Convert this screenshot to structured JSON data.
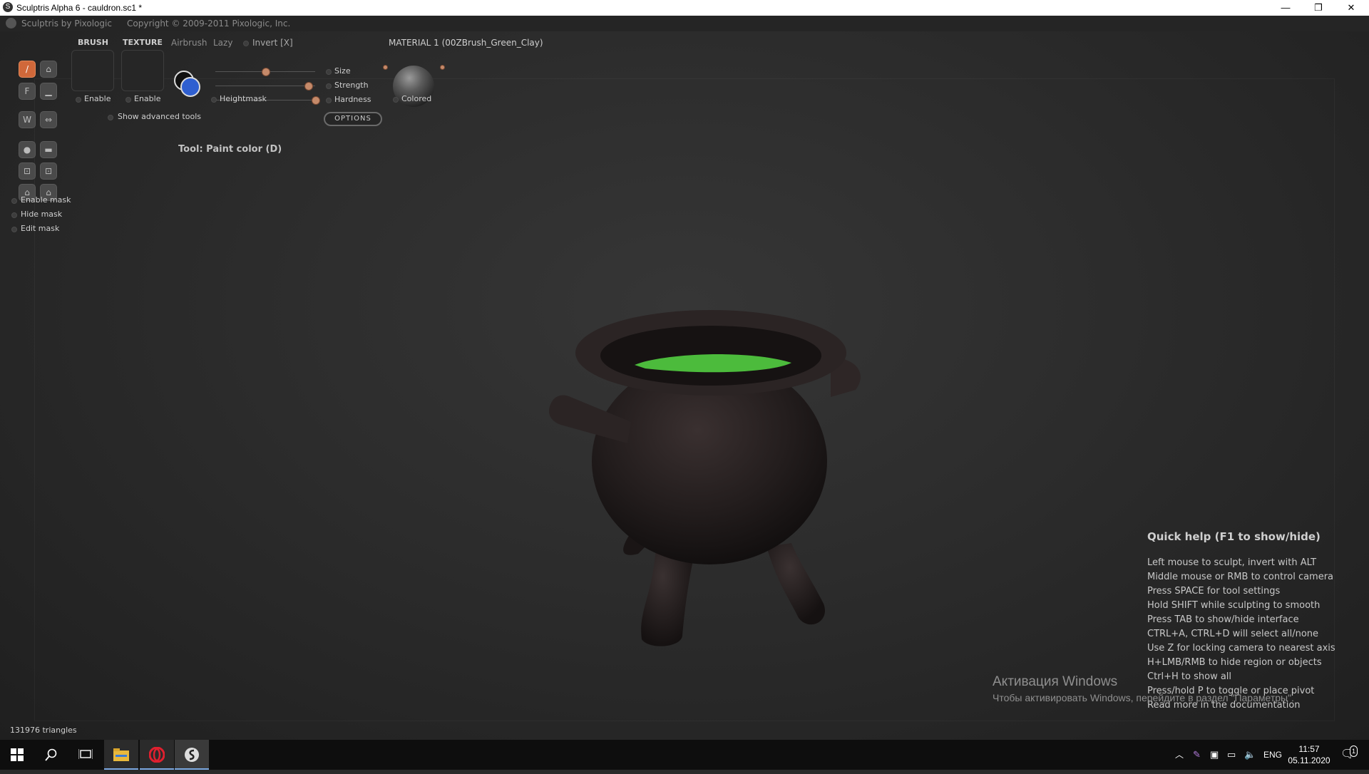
{
  "window": {
    "title": "Sculptris Alpha 6 - cauldron.sc1 *",
    "minimize_glyph": "—",
    "maximize_glyph": "❐",
    "close_glyph": "✕"
  },
  "app_header": {
    "name": "Sculptris by Pixologic",
    "copyright": "Copyright © 2009-2011 Pixologic, Inc."
  },
  "toolbar": {
    "brush_label": "BRUSH",
    "texture_label": "TEXTURE",
    "airbrush_label": "Airbrush",
    "lazy_label": "Lazy",
    "invert_label": "Invert [X]",
    "brush_enable": "Enable",
    "texture_enable": "Enable",
    "heightmask_label": "Heightmask",
    "show_advanced": "Show advanced tools",
    "options_label": "OPTIONS",
    "material_label": "MATERIAL 1 (00ZBrush_Green_Clay)",
    "colored_label": "Colored",
    "sliders": [
      {
        "label": "Size",
        "value": 0.5
      },
      {
        "label": "Strength",
        "value": 0.93
      },
      {
        "label": "Hardness",
        "value": 1.0
      }
    ]
  },
  "tools": [
    {
      "name": "paint-color-tool",
      "glyph": "/",
      "active": true
    },
    {
      "name": "paint-bump-tool",
      "glyph": "⌂",
      "active": false
    },
    {
      "name": "flatten-tool",
      "glyph": "F",
      "active": false
    },
    {
      "name": "smooth-tool",
      "glyph": "▁",
      "active": false
    },
    {
      "name": "wave-tool",
      "glyph": "W",
      "active": false
    },
    {
      "name": "grab-tool",
      "glyph": "⇔",
      "active": false
    },
    {
      "name": "sphere-tool",
      "glyph": "●",
      "active": false
    },
    {
      "name": "crease-tool",
      "glyph": "▬",
      "active": false
    },
    {
      "name": "import-tool",
      "glyph": "⊡",
      "active": false
    },
    {
      "name": "export-tool",
      "glyph": "⊡",
      "active": false
    },
    {
      "name": "save-tool",
      "glyph": "⌂",
      "active": false
    },
    {
      "name": "open-tool",
      "glyph": "⌂",
      "active": false
    }
  ],
  "mask": {
    "enable": "Enable mask",
    "hide": "Hide mask",
    "edit": "Edit mask"
  },
  "current_tool": "Tool: Paint color (D)",
  "triangles": "131976 triangles",
  "quick_help": {
    "heading": "Quick help (F1 to show/hide)",
    "lines": [
      "Left mouse to sculpt, invert with ALT",
      "Middle mouse or RMB to control camera",
      "Press SPACE for tool settings",
      "Hold SHIFT while sculpting to smooth",
      "Press TAB to show/hide interface",
      "CTRL+A, CTRL+D will select all/none",
      "Use Z for locking camera to nearest axis",
      "H+LMB/RMB to hide region or objects",
      "Ctrl+H to show all",
      "Press/hold P to toggle or place pivot",
      "Read more in the documentation"
    ]
  },
  "activation": {
    "title": "Активация Windows",
    "subtitle": "Чтобы активировать Windows, перейдите в раздел \"Параметры\"."
  },
  "taskbar": {
    "language": "ENG",
    "time": "11:57",
    "date": "05.11.2020",
    "notification_count": "1"
  },
  "colors": {
    "accent_tool": "#d0683a",
    "liquid": "#4cbb3c",
    "cauldron": "#2a2424",
    "taskbar": "#0e0e0e"
  }
}
